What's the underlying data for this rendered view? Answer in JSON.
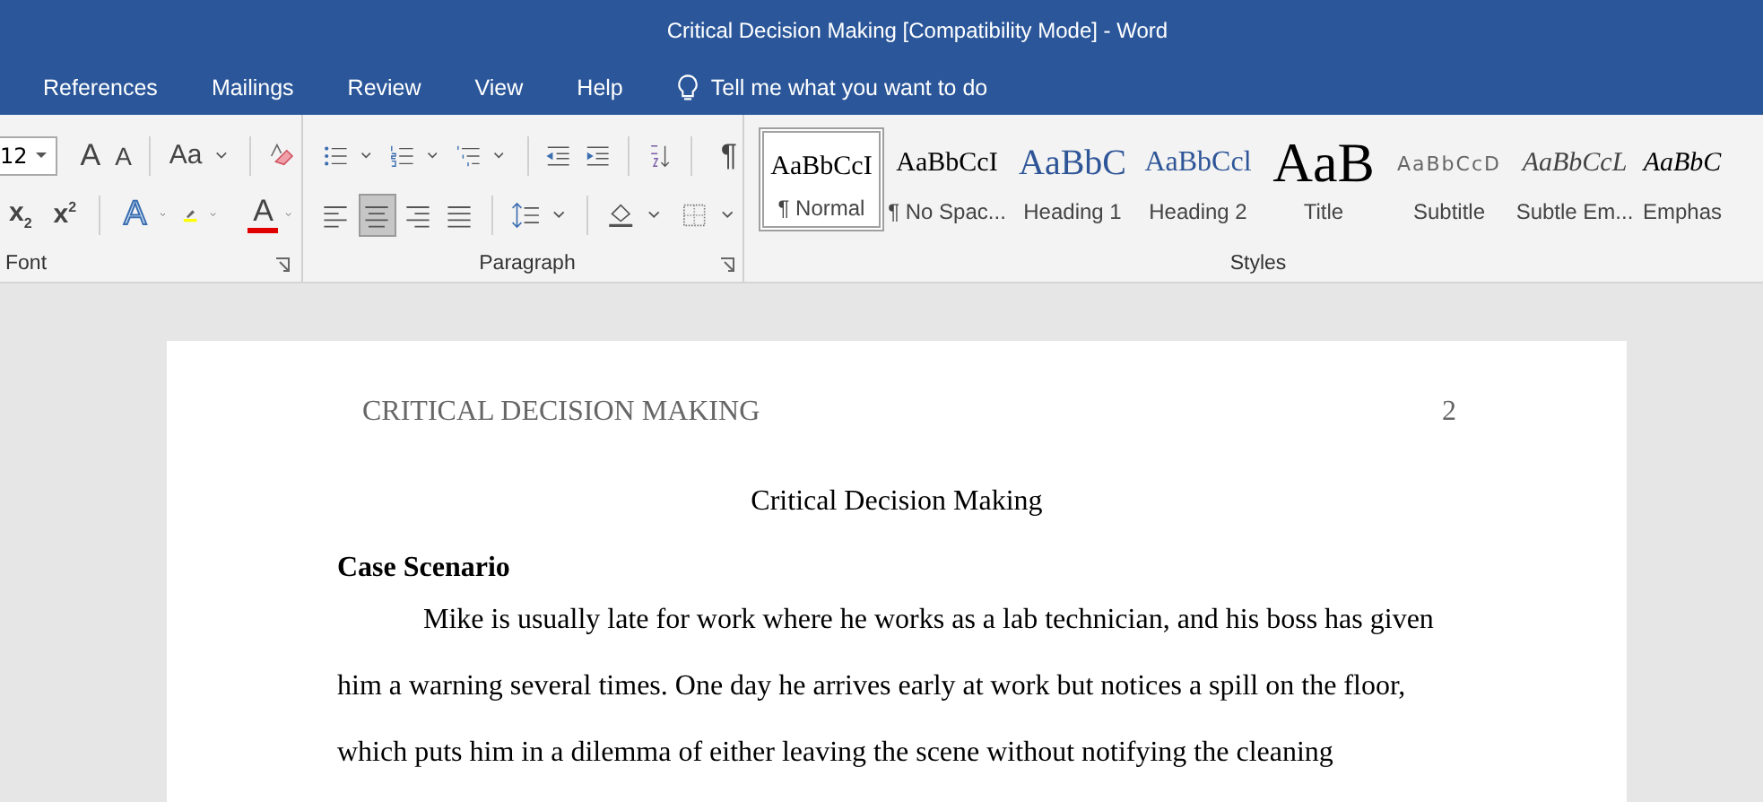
{
  "window": {
    "title": "Critical Decision Making [Compatibility Mode]  -  Word"
  },
  "tabs": [
    {
      "label": "References"
    },
    {
      "label": "Mailings"
    },
    {
      "label": "Review"
    },
    {
      "label": "View"
    },
    {
      "label": "Help"
    }
  ],
  "tell_me": {
    "placeholder": "Tell me what you want to do"
  },
  "font_group": {
    "label": "Font",
    "size": "12",
    "grow": "A",
    "shrink": "A",
    "case": "Aa",
    "subscript": "x",
    "subscript_mark": "2",
    "superscript": "x",
    "superscript_mark": "2",
    "effects": "A",
    "color_glyph": "A"
  },
  "paragraph_group": {
    "label": "Paragraph",
    "pilcrow": "¶",
    "align_buttons": [
      {
        "kind": "left",
        "selected": false
      },
      {
        "kind": "center",
        "selected": true
      },
      {
        "kind": "right",
        "selected": false
      },
      {
        "kind": "justify",
        "selected": false
      }
    ]
  },
  "styles_group": {
    "label": "Styles",
    "items": [
      {
        "kind": "normal",
        "preview": "AaBbCcI",
        "label": "¶ Normal",
        "selected": true
      },
      {
        "kind": "normal",
        "preview": "AaBbCcI",
        "label": "¶ No Spac...",
        "selected": false
      },
      {
        "kind": "heading1",
        "preview": "AaBbC",
        "label": "Heading 1",
        "selected": false
      },
      {
        "kind": "heading2",
        "preview": "AaBbCcl",
        "label": "Heading 2",
        "selected": false
      },
      {
        "kind": "title",
        "preview": "AaB",
        "label": "Title",
        "selected": false
      },
      {
        "kind": "subtitle",
        "preview": "AaBbCcD",
        "label": "Subtitle",
        "selected": false
      },
      {
        "kind": "subtle",
        "preview": "AaBbCcL",
        "label": "Subtle Em...",
        "selected": false
      },
      {
        "kind": "emphasis",
        "preview": "AaBbC",
        "label": "Emphas",
        "selected": false
      }
    ]
  },
  "document": {
    "header": "CRITICAL DECISION MAKING",
    "page_number": "2",
    "title": "Critical Decision Making",
    "heading": "Case Scenario",
    "paragraph": "Mike is usually late for work where he works as a lab technician, and his boss has given him a warning several times. One day he arrives early at work but notices a spill on the floor, which puts him in a dilemma of either leaving the scene without notifying the cleaning"
  }
}
